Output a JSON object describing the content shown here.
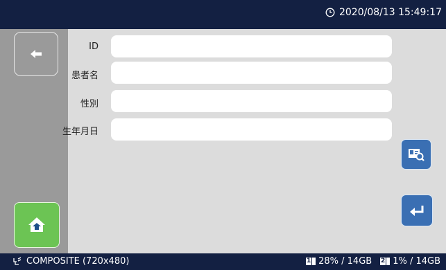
{
  "header": {
    "datetime": "2020/08/13 15:49:17"
  },
  "form": {
    "id_label": "ID",
    "name_label": "患者名",
    "sex_label": "性別",
    "birth_label": "生年月日",
    "id_value": "",
    "name_value": "",
    "sex_value": "",
    "birth_value": ""
  },
  "footer": {
    "source": "COMPOSITE (720x480)",
    "disk1": "28% / 14GB",
    "disk2": "1% / 14GB",
    "disk1_index": "1",
    "disk2_index": "2"
  },
  "icons": {
    "clock": "clock-icon",
    "back": "arrow-left-icon",
    "home": "home-icon",
    "search": "patient-search-icon",
    "enter": "enter-icon",
    "source": "video-source-icon"
  },
  "colors": {
    "topbar": "#132042",
    "sidebar": "#9a9a9a",
    "home_button": "#6cc454",
    "action_button": "#3a6fb3"
  }
}
